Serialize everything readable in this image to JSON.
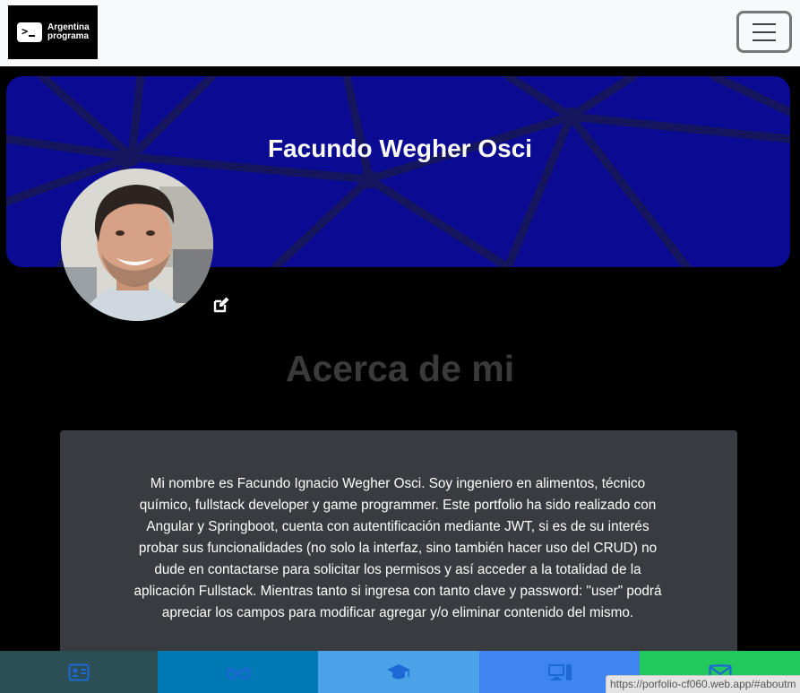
{
  "navbar": {
    "brand_line1": "Argentina",
    "brand_line2": "programa",
    "brand_icon": "terminal-prompt-icon",
    "toggler_icon": "hamburger-menu-icon"
  },
  "banner": {
    "name": "Facundo Wegher Osci",
    "color": "#0a0a92"
  },
  "profile": {
    "avatar": "profile-photo",
    "edit_icon": "edit-pencil-icon"
  },
  "about": {
    "title": "Acerca de mi",
    "text": "Mi nombre es Facundo Ignacio Wegher Osci. Soy ingeniero en alimentos, técnico químico, fullstack developer y game programmer. Este portfolio ha sido realizado con Angular y Springboot, cuenta con autentificación mediante JWT, si es de su interés probar sus funcionalidades (no solo la interfaz, sino también hacer uso del CRUD) no dude en contactarse para solicitar los permisos y así acceder a la totalidad de la aplicación Fullstack. Mientras tanto si ingresa con tanto clave y password: \"user\" podrá apreciar los campos para modificar agregar y/o eliminar contenido del mismo."
  },
  "bottom_nav": [
    {
      "icon": "id-card-icon",
      "color": "#2c4f55"
    },
    {
      "icon": "glasses-icon",
      "color": "#0079b5"
    },
    {
      "icon": "graduation-cap-icon",
      "color": "#4aa3e6"
    },
    {
      "icon": "computer-desktop-icon",
      "color": "#3f85f2"
    },
    {
      "icon": "envelope-icon",
      "color": "#21c85b"
    }
  ],
  "status_bar": {
    "url": "https://porfolio-cf060.web.app/#aboutm"
  }
}
